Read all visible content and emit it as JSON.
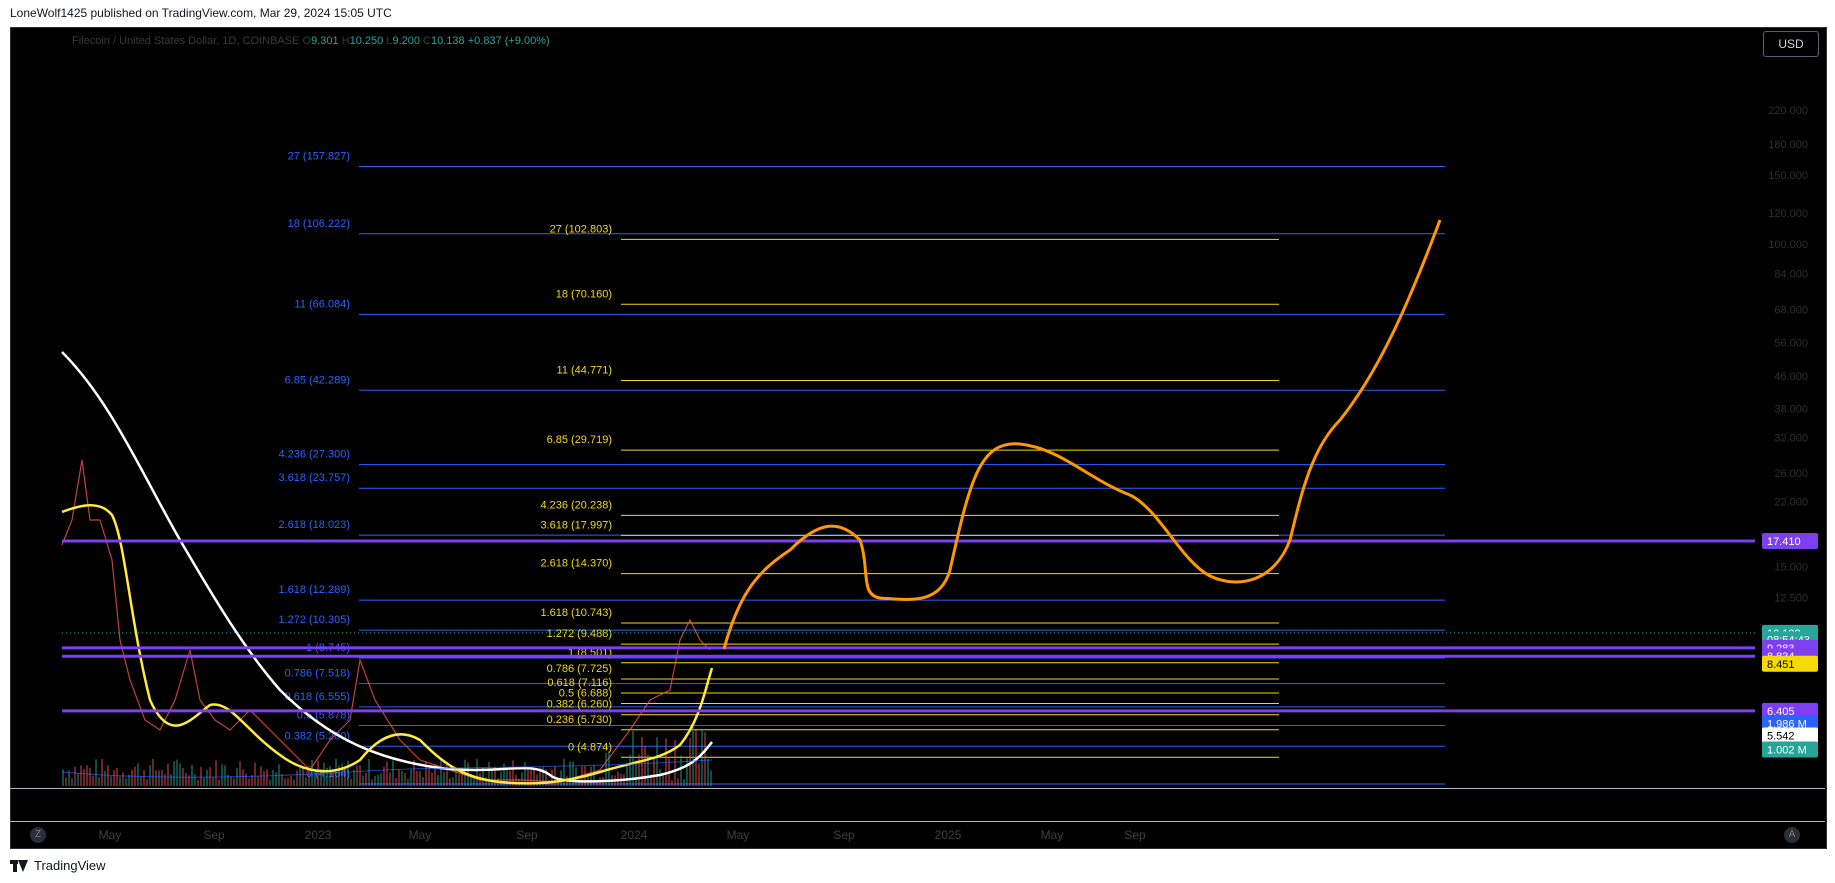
{
  "header": {
    "publish_line": "LoneWolf1425 published on TradingView.com, Mar 29, 2024 15:05 UTC"
  },
  "legend": {
    "symbol_text": "Filecoin / United States Dollar, 1D, COINBASE",
    "o_label": "O",
    "o_value": "9.301",
    "h_label": "H",
    "h_value": "10.250",
    "l_label": "L",
    "l_value": "9.200",
    "c_label": "C",
    "c_value": "10.138",
    "change": "+0.837 (+9.00%)"
  },
  "currency_button": "USD",
  "footer": {
    "brand": "TradingView"
  },
  "time_axis": {
    "left_button": "Z",
    "right_button": "A",
    "labels": [
      "May",
      "Sep",
      "2023",
      "May",
      "Sep",
      "2024",
      "May",
      "Sep",
      "2025",
      "May",
      "Sep"
    ]
  },
  "colors": {
    "background": "#000000",
    "fib_blue": "#2962ff",
    "fib_yellow": "#f5d90a",
    "projection_orange": "#ff9800",
    "support_purple": "#7e3ff2",
    "ma_white": "#ffffff",
    "ma_yellow": "#ffeb3b",
    "candle_up": "#26a69a",
    "candle_down": "#ef5350"
  },
  "chart_data": {
    "type": "line",
    "scale": "log",
    "price_axis_labels": [
      "220.000",
      "180.000",
      "150.000",
      "120.000",
      "100.000",
      "84.000",
      "68.000",
      "56.000",
      "46.000",
      "38.000",
      "32.000",
      "26.000",
      "22.000",
      "15.000",
      "12.500"
    ],
    "fib_blue": [
      {
        "level": "27",
        "price": "157.827"
      },
      {
        "level": "18",
        "price": "106.222"
      },
      {
        "level": "11",
        "price": "66.084"
      },
      {
        "level": "6.85",
        "price": "42.289"
      },
      {
        "level": "4.236",
        "price": "27.300"
      },
      {
        "level": "3.618",
        "price": "23.757"
      },
      {
        "level": "2.618",
        "price": "18.023"
      },
      {
        "level": "1.618",
        "price": "12.289"
      },
      {
        "level": "1.272",
        "price": "10.305"
      },
      {
        "level": "1",
        "price": "8.745"
      },
      {
        "level": "0.786",
        "price": "7.518"
      },
      {
        "level": "0.618",
        "price": "6.555"
      },
      {
        "level": "0.5",
        "price": "5.878"
      },
      {
        "level": "0.382",
        "price": "5.200"
      },
      {
        "level": "0",
        "price": "4.164"
      }
    ],
    "fib_yellow": [
      {
        "level": "27",
        "price": "102.803"
      },
      {
        "level": "18",
        "price": "70.160"
      },
      {
        "level": "11",
        "price": "44.771"
      },
      {
        "level": "6.85",
        "price": "29.719"
      },
      {
        "level": "4.236",
        "price": "20.238"
      },
      {
        "level": "3.618",
        "price": "17.997"
      },
      {
        "level": "2.618",
        "price": "14.370"
      },
      {
        "level": "1.618",
        "price": "10.743"
      },
      {
        "level": "1.272",
        "price": "9.488"
      },
      {
        "level": "1",
        "price": "8.501"
      },
      {
        "level": "0.786",
        "price": "7.725"
      },
      {
        "level": "0.618",
        "price": "7.116"
      },
      {
        "level": "0.5",
        "price": "6.688"
      },
      {
        "level": "0.382",
        "price": "6.260"
      },
      {
        "level": "0.236",
        "price": "5.730"
      },
      {
        "level": "0",
        "price": "4.874"
      }
    ],
    "purple_lines": [
      "17.410",
      "9.283",
      "8.834",
      "6.405"
    ],
    "price_badges": [
      {
        "text": "17.410",
        "color": "#7e3ff2",
        "price": "17.410"
      },
      {
        "text": "10.138",
        "color": "#26a69a",
        "price": "10.138"
      },
      {
        "text": "08:54:43",
        "color": "#26a69a",
        "price": "9.75"
      },
      {
        "text": "9.283",
        "color": "#7e3ff2",
        "price": "9.283"
      },
      {
        "text": "8.834",
        "color": "#7e3ff2",
        "price": "8.834"
      },
      {
        "text": "8.451",
        "color": "#f5d90a",
        "price": "8.451"
      },
      {
        "text": "6.405",
        "color": "#7e3ff2",
        "price": "6.405"
      },
      {
        "text": "1.986 M",
        "color": "#2962ff",
        "price": "5.95"
      },
      {
        "text": "5.542",
        "color": "#ffffff",
        "price": "5.542"
      },
      {
        "text": "1.002 M",
        "color": "#26a69a",
        "price": "5.1"
      }
    ]
  }
}
